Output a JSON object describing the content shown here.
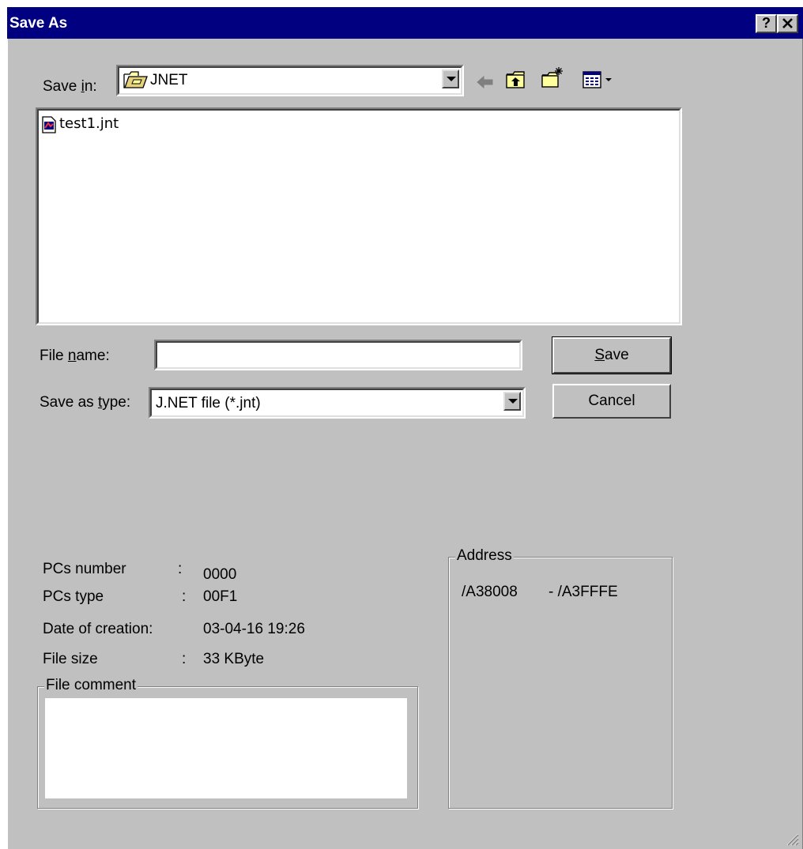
{
  "dialog": {
    "title": "Save As",
    "help_label": "?",
    "close_label": "✕"
  },
  "save_in": {
    "label_pre": "Save ",
    "label_ul": "i",
    "label_post": "n:",
    "value": "JNET"
  },
  "files": [
    {
      "name": "test1.jnt",
      "icon": "jnt-file-icon"
    }
  ],
  "file_name": {
    "label_pre": "File ",
    "label_ul": "n",
    "label_post": "ame:",
    "value": ""
  },
  "save_type": {
    "label_pre": "Save as ",
    "label_ul": "t",
    "label_post": "ype:",
    "value": "J.NET file (*.jnt)"
  },
  "buttons": {
    "save_ul": "S",
    "save_rest": "ave",
    "cancel": "Cancel"
  },
  "info": {
    "pcs_number_label": "PCs number",
    "pcs_number_sep": ":",
    "pcs_number_value": "0000",
    "pcs_type_label": "PCs type",
    "pcs_type_sep": ":",
    "pcs_type_value": "00F1",
    "date_label": "Date of creation:",
    "date_value": "03-04-16 19:26",
    "size_label": "File size",
    "size_sep": ":",
    "size_value": "33 KByte"
  },
  "comment": {
    "legend": "File comment",
    "value": ""
  },
  "address": {
    "legend": "Address",
    "start": "/A38008",
    "end": "- /A3FFFE"
  },
  "colors": {
    "title_bar": "#000080",
    "face": "#c0c0c0",
    "window": "#ffffff"
  }
}
